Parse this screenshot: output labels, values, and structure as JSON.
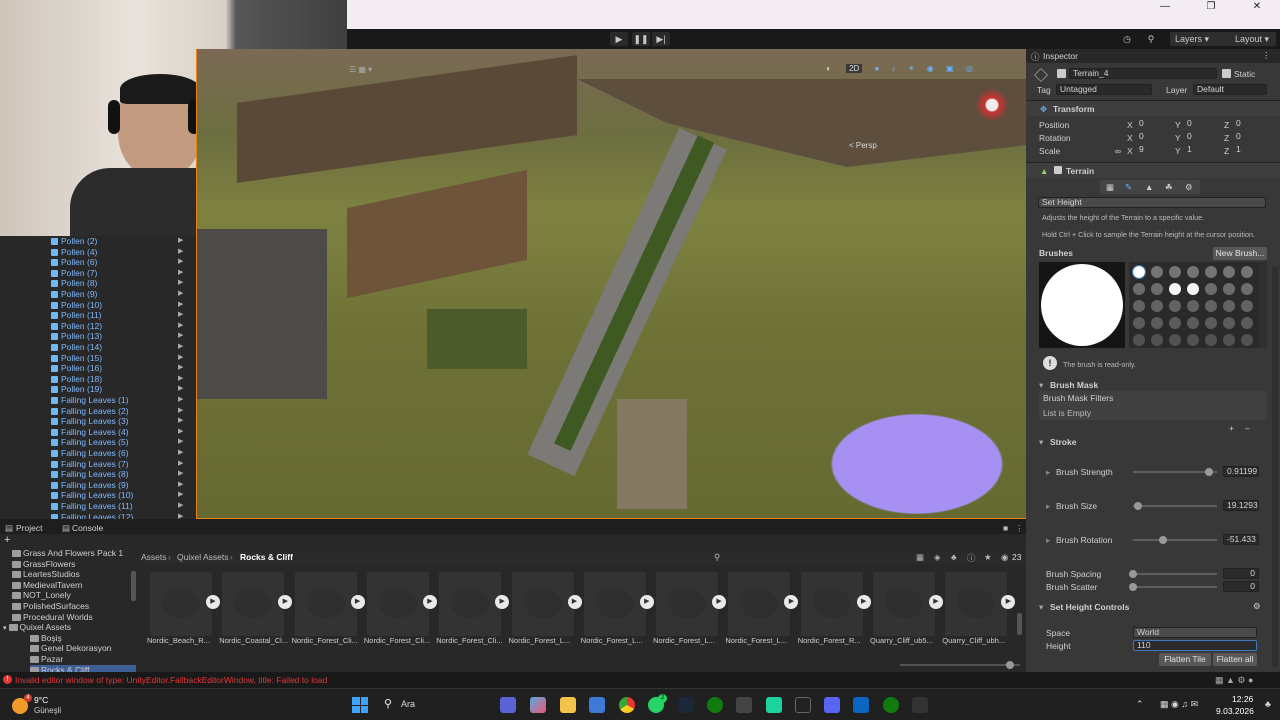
{
  "toolbar": {
    "layers": "Layers",
    "layout": "Layout"
  },
  "scene": {
    "mode_2d": "2D",
    "persp": "< Persp"
  },
  "hierarchy": {
    "items": [
      "Pollen (2)",
      "Pollen (4)",
      "Pollen (6)",
      "Pollen (7)",
      "Pollen (8)",
      "Pollen (9)",
      "Pollen (10)",
      "Pollen (11)",
      "Pollen (12)",
      "Pollen (13)",
      "Pollen (14)",
      "Pollen (15)",
      "Pollen (16)",
      "Pollen (18)",
      "Pollen (19)",
      "Falling Leaves (1)",
      "Falling Leaves (2)",
      "Falling Leaves (3)",
      "Falling Leaves (4)",
      "Falling Leaves (5)",
      "Falling Leaves (6)",
      "Falling Leaves (7)",
      "Falling Leaves (8)",
      "Falling Leaves (9)",
      "Falling Leaves (10)",
      "Falling Leaves (11)",
      "Falling Leaves (12)"
    ]
  },
  "inspector": {
    "tab": "Inspector",
    "object_name": "Terrain_4",
    "static": "Static",
    "tag_label": "Tag",
    "tag_value": "Untagged",
    "layer_label": "Layer",
    "layer_value": "Default",
    "transform": "Transform",
    "position_label": "Position",
    "rotation_label": "Rotation",
    "scale_label": "Scale",
    "x": "X",
    "y": "Y",
    "z": "Z",
    "position": {
      "x": "0",
      "y": "0",
      "z": "0"
    },
    "rotation": {
      "x": "0",
      "y": "0",
      "z": "0"
    },
    "scale": {
      "x": "9",
      "y": "1",
      "z": "1"
    },
    "terrain": "Terrain",
    "tool": "Set Height",
    "desc1": "Adjusts the height of the Terrain to a specific value.",
    "desc2": "Hold Ctrl + Click to sample the Terrain height at the cursor position.",
    "brushes": "Brushes",
    "new_brush": "New Brush...",
    "readonly": "The brush is read-only.",
    "brush_mask": "Brush Mask",
    "brush_mask_filters": "Brush Mask Filters",
    "list_empty": "List is Empty",
    "stroke": "Stroke",
    "brush_strength": {
      "label": "Brush Strength",
      "value": "0.91199",
      "level": 0.91
    },
    "brush_size": {
      "label": "Brush Size",
      "value": "19.1293",
      "level": 0.06
    },
    "brush_rotation": {
      "label": "Brush Rotation",
      "value": "-51.433",
      "level": 0.36
    },
    "brush_spacing": {
      "label": "Brush Spacing",
      "value": "0",
      "level": 0
    },
    "brush_scatter": {
      "label": "Brush Scatter",
      "value": "0",
      "level": 0
    },
    "set_height_controls": "Set Height Controls",
    "space_label": "Space",
    "space_value": "World",
    "height_label": "Height",
    "height_value": "110",
    "flatten_tile": "Flatten Tile",
    "flatten_all": "Flatten all"
  },
  "project": {
    "tab_project": "Project",
    "tab_console": "Console",
    "breadcrumb": [
      "Assets",
      "Quixel Assets",
      "Rocks & Cliff"
    ],
    "count": "23",
    "folders": [
      "Grass And Flowers Pack 1",
      "GrassFlowers",
      "LeartesStudios",
      "MedievalTavern",
      "NOT_Lonely",
      "PolishedSurfaces",
      "Procedural Worlds",
      "Quixel Assets",
      "Boşiş",
      "Genel Dekorasyon",
      "Pazar",
      "Rocks & Cliff"
    ],
    "assets": [
      "Nordic_Beach_R...",
      "Nordic_Coastal_Cl...",
      "Nordic_Forest_Cli...",
      "Nordic_Forest_Cli...",
      "Nordic_Forest_Cli...",
      "Nordic_Forest_L...",
      "Nordic_Forest_L...",
      "Nordic_Forest_L...",
      "Nordic_Forest_L...",
      "Nordic_Forest_R...",
      "Quarry_Cliff_ub5...",
      "Quarry_Cliff_ubh..."
    ]
  },
  "status": "Invalid editor window of type: UnityEditor.FallbackEditorWindow, title: Failed to load",
  "taskbar": {
    "temp": "9°C",
    "weather": "Güneşli",
    "search": "Ara",
    "badge": "2",
    "time": "12:26",
    "date": "9.03.2026"
  }
}
